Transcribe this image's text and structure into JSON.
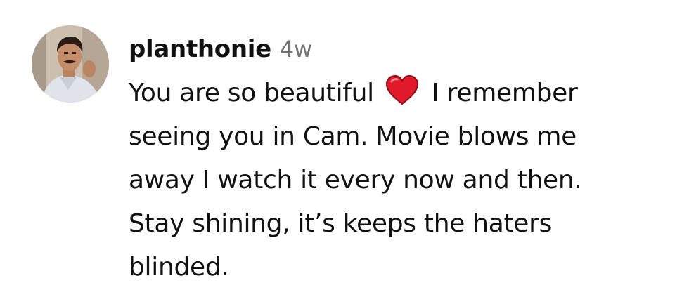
{
  "comment": {
    "username": "planthonie",
    "timestamp": "4w",
    "lines": [
      {
        "before": "You are so beautiful",
        "icon": "red-heart-emoji",
        "after": "I remember"
      },
      {
        "text": "seeing you in Cam. Movie blows me"
      },
      {
        "text": "away I watch it every now and then."
      },
      {
        "text": "Stay shining, it’s keeps the haters"
      },
      {
        "text": "blinded."
      }
    ]
  },
  "colors": {
    "text": "#111111",
    "timestamp": "#737373",
    "heart": "#e0192b"
  }
}
